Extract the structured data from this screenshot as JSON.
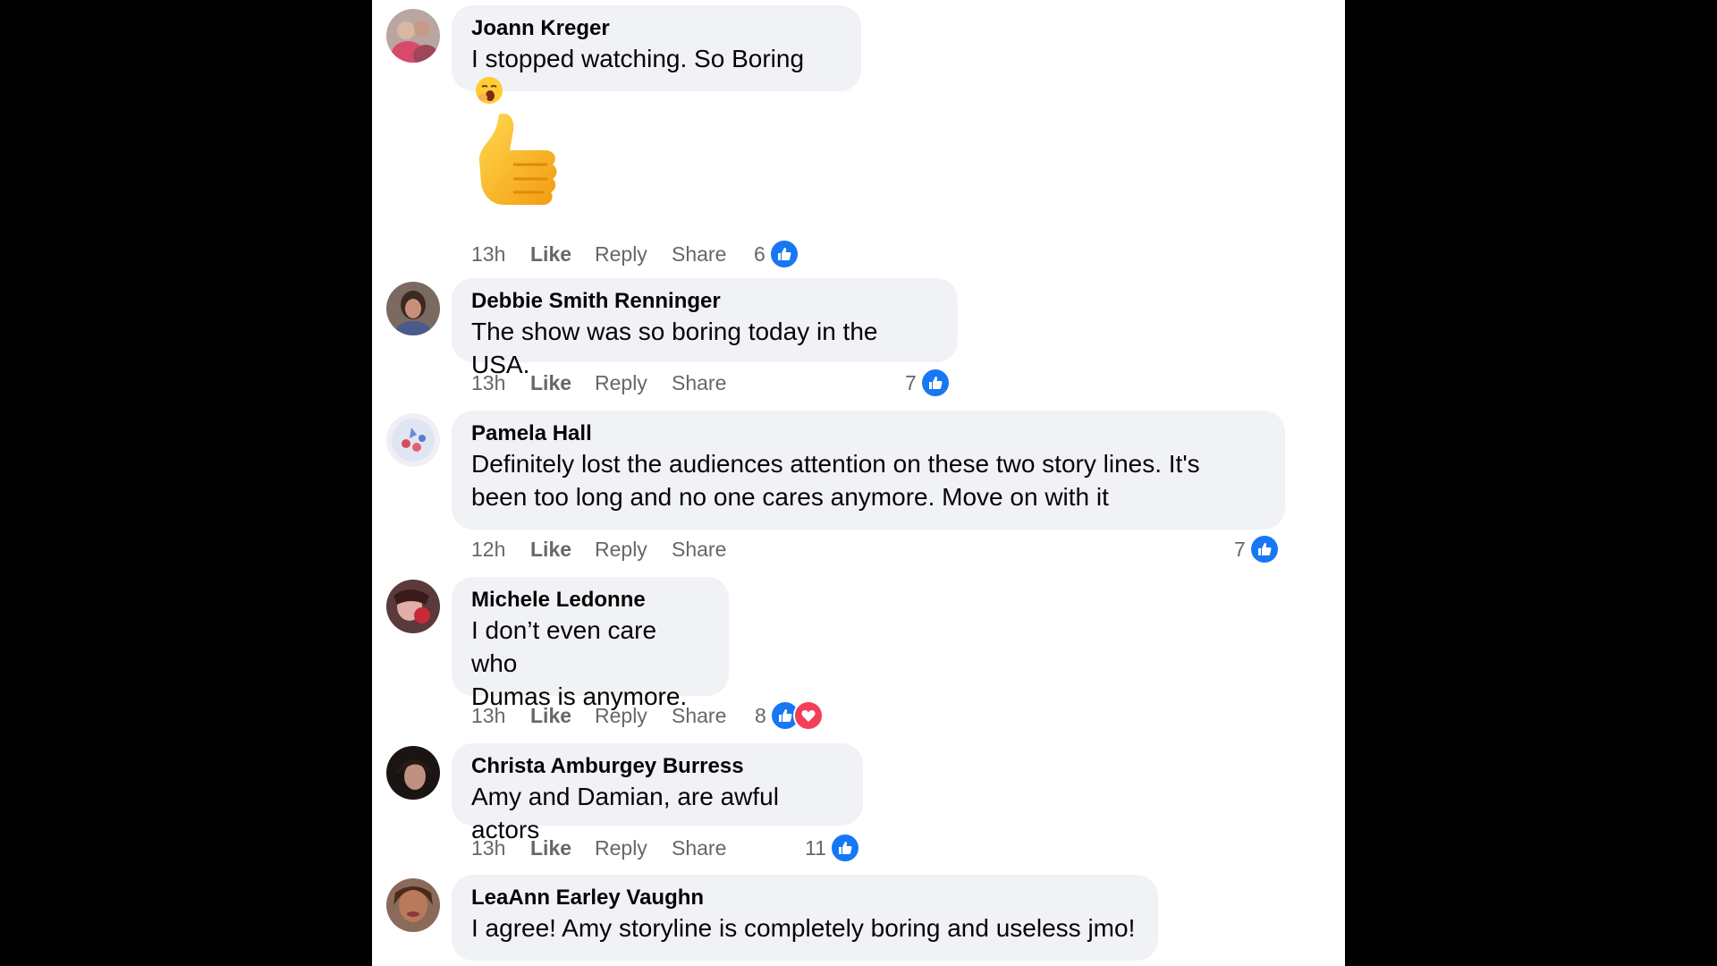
{
  "comments": [
    {
      "author": "Joann Kreger",
      "text": "I stopped watching. So Boring",
      "inline_emoji": "yawning-face",
      "sticker": "thumbs-up",
      "time": "13h",
      "like_label": "Like",
      "reply_label": "Reply",
      "share_label": "Share",
      "reaction_count": "6",
      "reactions": [
        "like"
      ]
    },
    {
      "author": "Debbie Smith Renninger",
      "text": "The show was so boring today in the USA.",
      "time": "13h",
      "like_label": "Like",
      "reply_label": "Reply",
      "share_label": "Share",
      "reaction_count": "7",
      "reactions": [
        "like"
      ]
    },
    {
      "author": "Pamela Hall",
      "text_lines": [
        "Definitely lost the audiences attention on these two story lines. It's",
        "been too long and no one cares anymore. Move on with it"
      ],
      "time": "12h",
      "like_label": "Like",
      "reply_label": "Reply",
      "share_label": "Share",
      "reaction_count": "7",
      "reactions": [
        "like"
      ]
    },
    {
      "author": "Michele Ledonne",
      "text_lines": [
        "I don’t even care who",
        "Dumas is anymore."
      ],
      "time": "13h",
      "like_label": "Like",
      "reply_label": "Reply",
      "share_label": "Share",
      "reaction_count": "8",
      "reactions": [
        "like",
        "love"
      ]
    },
    {
      "author": "Christa Amburgey Burress",
      "text": "Amy and Damian, are awful actors",
      "time": "13h",
      "like_label": "Like",
      "reply_label": "Reply",
      "share_label": "Share",
      "reaction_count": "11",
      "reactions": [
        "like"
      ]
    },
    {
      "author": "LeaAnn Earley Vaughn",
      "text": "I agree! Amy storyline is completely boring and useless jmo!"
    }
  ],
  "colors": {
    "background": "#000000",
    "panel": "#ffffff",
    "bubble": "#f0f2f5",
    "meta_text": "#65676b",
    "like_blue": "#1877f2",
    "love_red": "#f33e58"
  }
}
